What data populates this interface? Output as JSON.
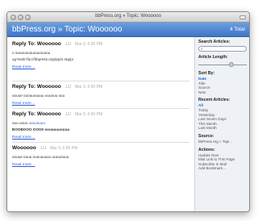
{
  "window": {
    "title": "bbPress.org » Topic: Woooooo"
  },
  "header": {
    "title": "bbPress.org » Topic: Woooooo",
    "total": "4 Total"
  },
  "posts": [
    {
      "title": "Reply To: Woooooo",
      "author": "JJJ",
      "date": "Mar 3, 6:00 PM",
      "line1": "o ouuououououuouuou",
      "line2": "ug?ewb?//p://bbpress.org//pp/o.ntg/pi",
      "read_more": "Read more…"
    },
    {
      "title": "Reply To: Woooooo",
      "author": "JJJ",
      "date": "Mar 3, 6:00 PM",
      "line1": "oouue ououuouuuu uuuouu ouu",
      "read_more": "Read more…"
    },
    {
      "title": "Reply To: Woooooo",
      "author": "JJJ",
      "date": "Mar 3, 6:00 PM",
      "line1_text": "ouu uouo ",
      "line1_link": "uouuouuu",
      "line2": "BOOBOOO OOO0 ooouuuuouuu",
      "read_more": "Read more…"
    },
    {
      "title": "Woooooo",
      "author": "JJJ",
      "date": "Mar 3, 6:00 PM",
      "line1": "oouue ouuu ououuuuou uuuuouuu",
      "read_more": "Read more…"
    }
  ],
  "sidebar": {
    "search_label": "Search Articles:",
    "search_placeholder": "",
    "length_label": "Article Length:",
    "length_value": 0.7,
    "sort_label": "Sort By:",
    "sort_items": [
      "Date",
      "Title",
      "Source",
      "New"
    ],
    "recent_label": "Recent Articles:",
    "recent_items": [
      "All",
      "Today",
      "Yesterday",
      "Last Seven Days",
      "This Month",
      "Last Month"
    ],
    "source_label": "Source:",
    "source_value": "bbPress.org » Topi…",
    "actions_label": "Actions:",
    "actions_items": [
      "Update Now",
      "Mail Link to This Page",
      "Subscribe in Mail",
      "Add Bookmark…"
    ]
  },
  "colors": {
    "header": "#4a82d2",
    "link": "#2a5bd7",
    "sidebar": "#eef1f5"
  }
}
